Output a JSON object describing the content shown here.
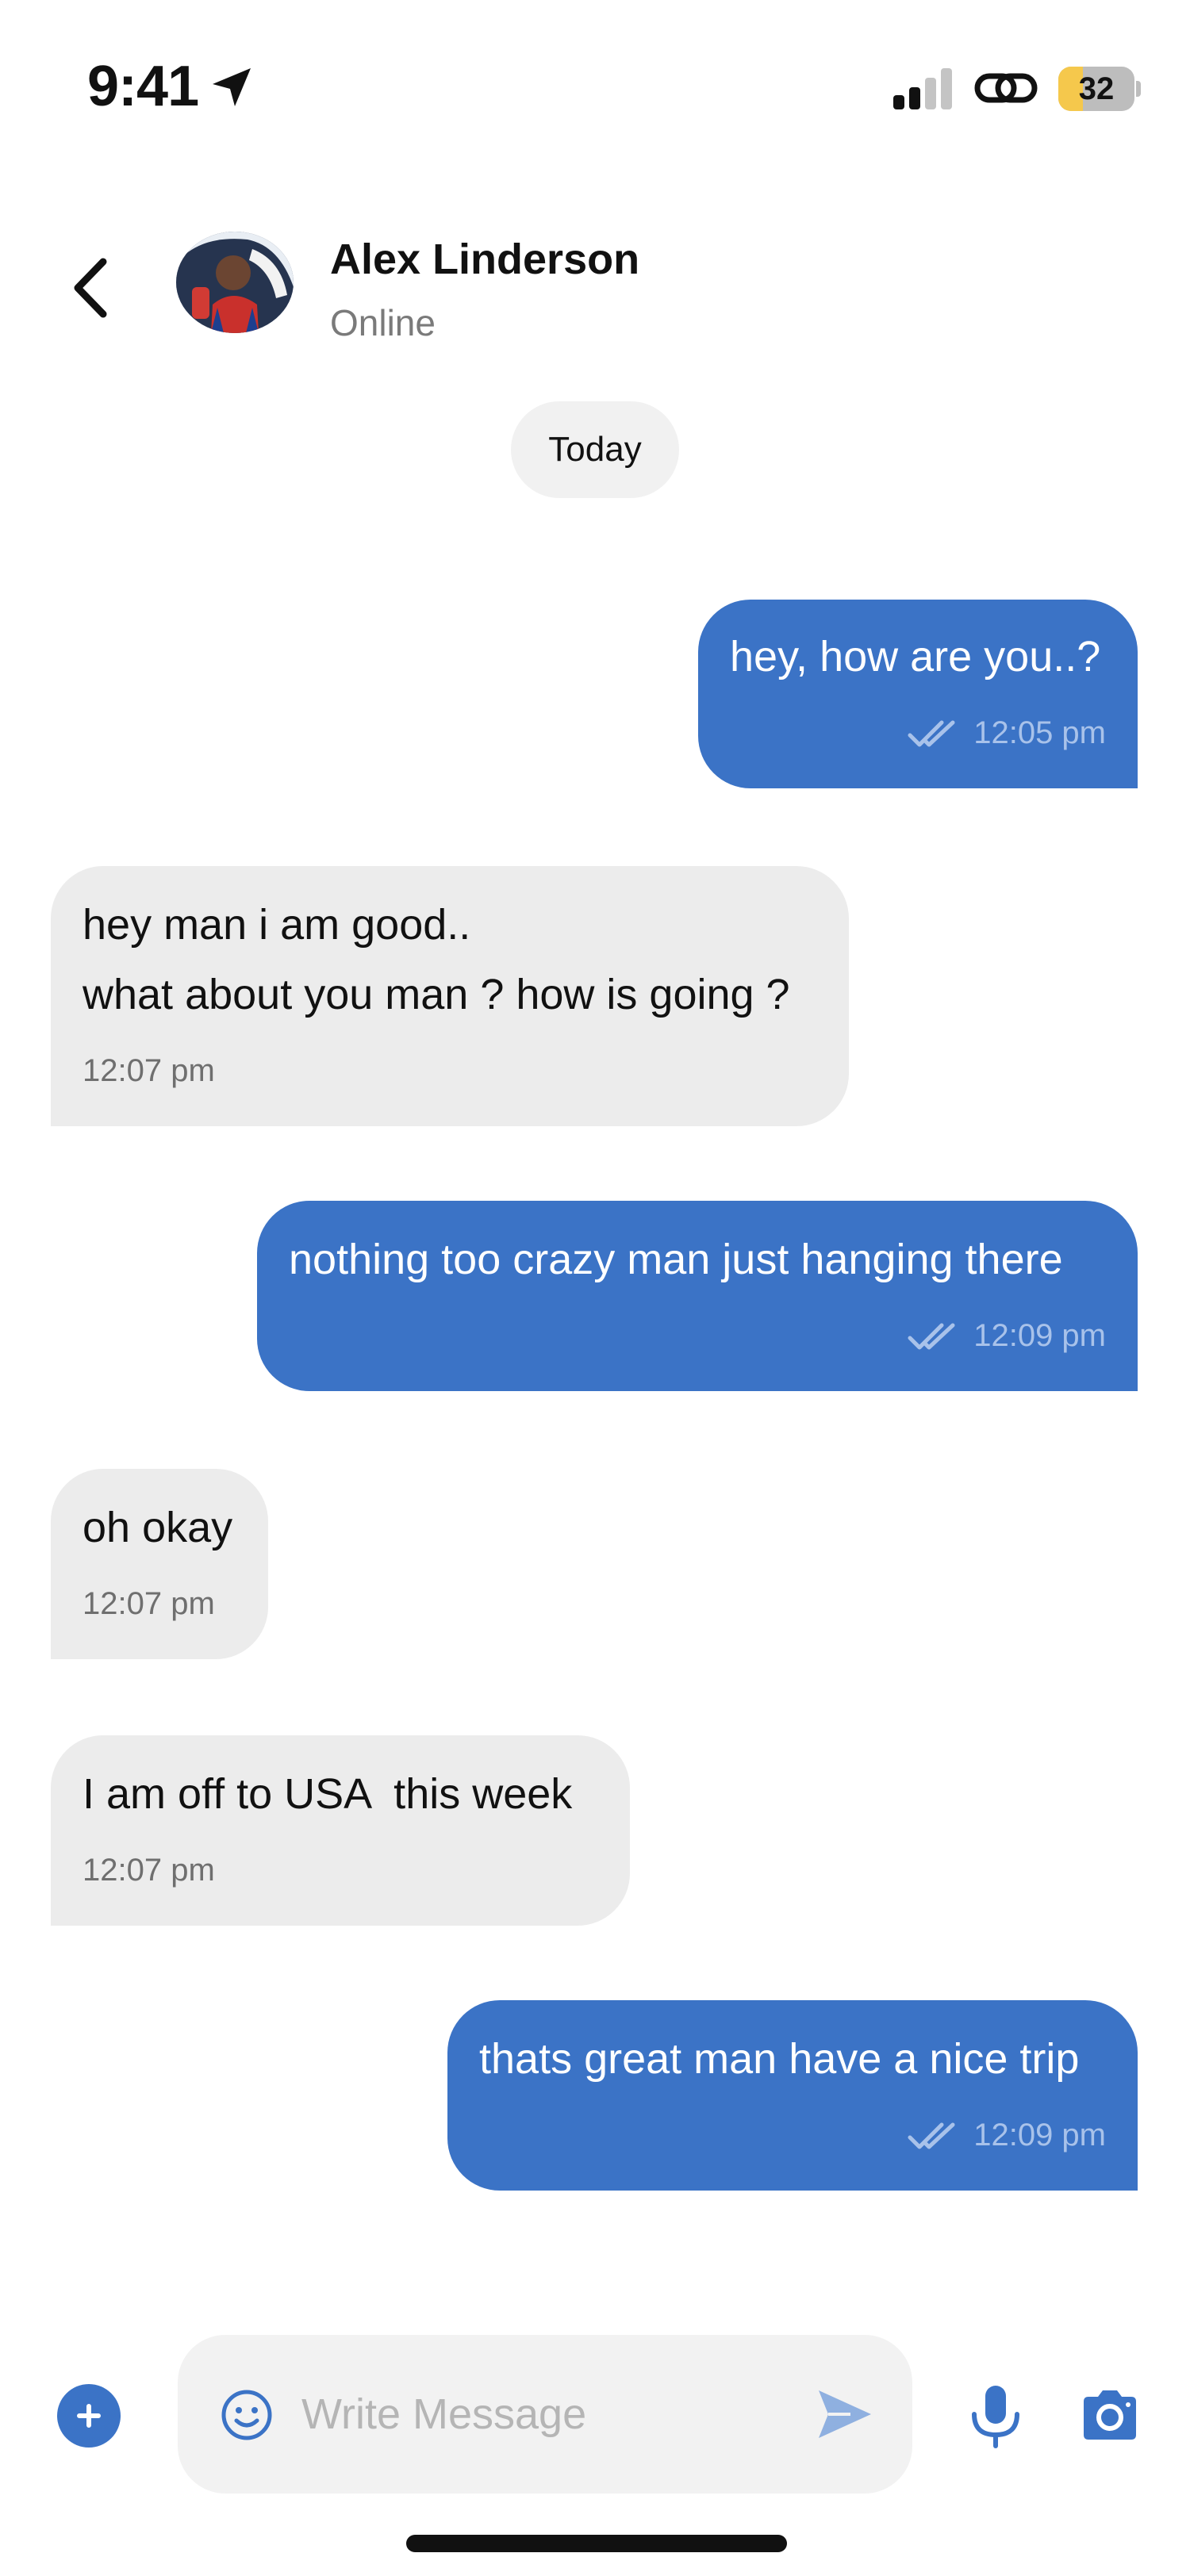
{
  "status_bar": {
    "time": "9:41",
    "battery": "32",
    "battery_level": 0.32,
    "icons": [
      "location-arrow-icon",
      "cellular-signal-icon",
      "personal-hotspot-icon",
      "battery-icon"
    ]
  },
  "header": {
    "back_icon": "chevron-left-icon",
    "contact_name": "Alex Linderson",
    "contact_status": "Online"
  },
  "date_separator": "Today",
  "messages": [
    {
      "direction": "sent",
      "lines": [
        "hey, how are you..?"
      ],
      "time": "12:05 pm",
      "read_icon": "double-check-icon"
    },
    {
      "direction": "received",
      "lines": [
        "hey man i am good..",
        "what about you man ? how is going ?"
      ],
      "time": "12:07 pm"
    },
    {
      "direction": "sent",
      "lines": [
        "nothing too crazy man just hanging there"
      ],
      "time": "12:09 pm",
      "read_icon": "double-check-icon"
    },
    {
      "direction": "received",
      "lines": [
        "oh okay"
      ],
      "time": "12:07 pm"
    },
    {
      "direction": "received",
      "lines": [
        "I am off to USA  this week"
      ],
      "time": "12:07 pm"
    },
    {
      "direction": "sent",
      "lines": [
        "thats great man have a nice trip"
      ],
      "time": "12:09 pm",
      "read_icon": "double-check-icon"
    }
  ],
  "composer": {
    "placeholder": "Write Message",
    "value": "",
    "icons": [
      "plus-icon",
      "emoji-icon",
      "send-icon",
      "microphone-icon",
      "camera-icon"
    ]
  },
  "colors": {
    "sent_bubble": "#3b73c6",
    "received_bubble": "#ececec",
    "accent": "#3b73c6",
    "battery_fill": "#f5c84c"
  }
}
